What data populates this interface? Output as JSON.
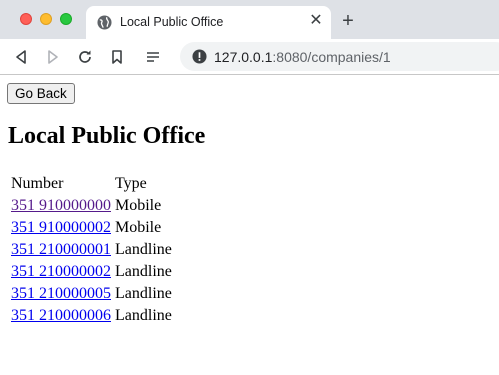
{
  "browser": {
    "tab": {
      "title": "Local Public Office"
    },
    "address_bar": {
      "url_host": "127.0.0.1",
      "url_rest": ":8080/companies/1"
    }
  },
  "page": {
    "go_back_label": "Go Back",
    "title": "Local Public Office",
    "table": {
      "headers": [
        "Number",
        "Type"
      ],
      "rows": [
        {
          "number": "351 910000000",
          "type": "Mobile",
          "visited": true
        },
        {
          "number": "351 910000002",
          "type": "Mobile",
          "visited": false
        },
        {
          "number": "351 210000001",
          "type": "Landline",
          "visited": false
        },
        {
          "number": "351 210000002",
          "type": "Landline",
          "visited": false
        },
        {
          "number": "351 210000005",
          "type": "Landline",
          "visited": false
        },
        {
          "number": "351 210000006",
          "type": "Landline",
          "visited": false
        }
      ]
    }
  }
}
